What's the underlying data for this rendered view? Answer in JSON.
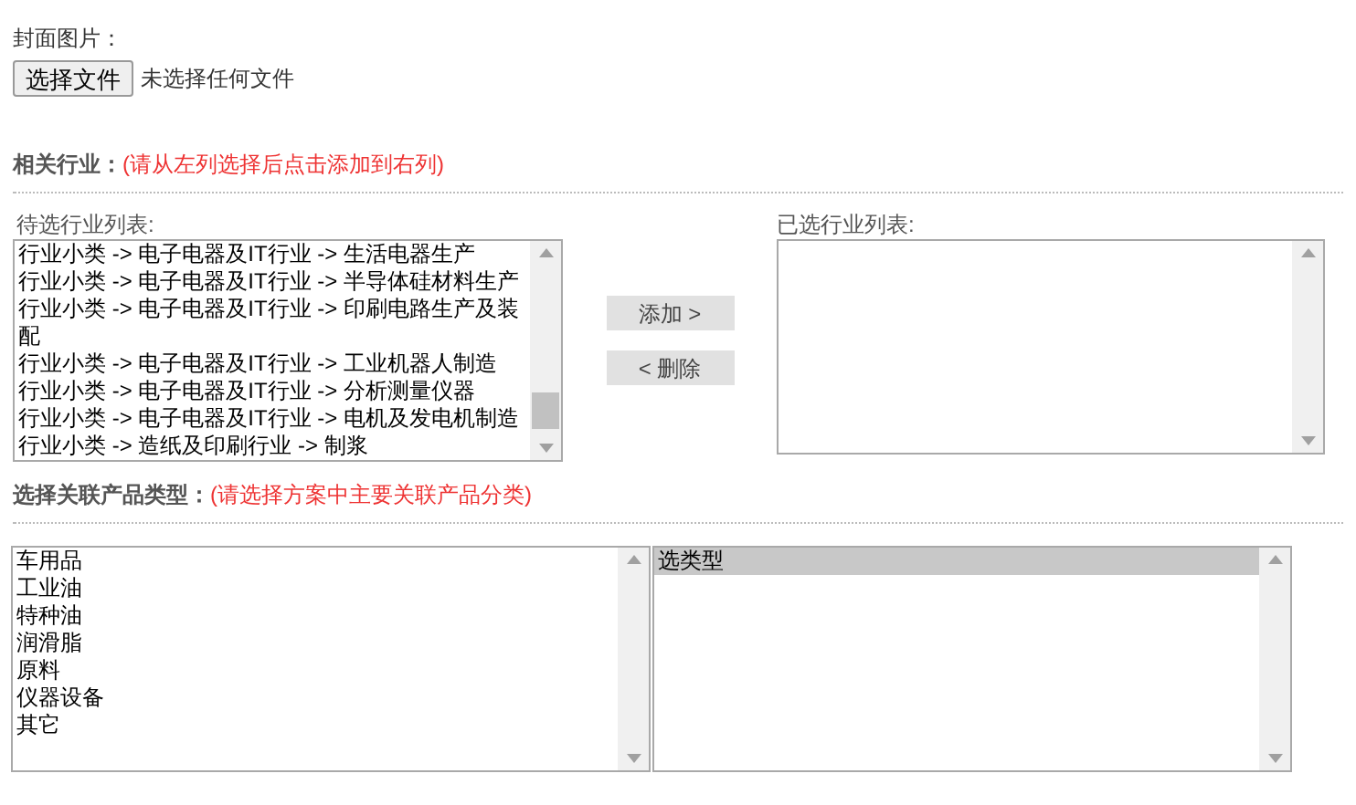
{
  "cover": {
    "label": "封面图片：",
    "button": "选择文件",
    "status": "未选择任何文件"
  },
  "industry": {
    "label": "相关行业：",
    "hint": "(请从左列选择后点击添加到右列)",
    "available_label": "待选行业列表:",
    "available": [
      {
        "text": "行业小类 -> 电子电器及IT行业 -> 生活电器生产",
        "selected": false
      },
      {
        "text": "行业小类 -> 电子电器及IT行业 -> 半导体硅材料生产",
        "selected": false
      },
      {
        "text": "行业小类 -> 电子电器及IT行业 -> 印刷电路生产及装配",
        "selected": false
      },
      {
        "text": "行业小类 -> 电子电器及IT行业 -> 工业机器人制造",
        "selected": false
      },
      {
        "text": "行业小类 -> 电子电器及IT行业 -> 分析测量仪器",
        "selected": false
      },
      {
        "text": "行业小类 -> 电子电器及IT行业 -> 电机及发电机制造",
        "selected": false
      },
      {
        "text": "行业小类 -> 造纸及印刷行业 -> 制浆",
        "selected": false
      }
    ],
    "buttons": [
      "添加 >",
      "< 删除"
    ],
    "chosen_label": "已选行业列表:"
  },
  "products": {
    "label": "选择关联产品类型：",
    "hint": "(请选择方案中主要关联产品分类)",
    "categories": [
      {
        "text": "车用品",
        "selected": false
      },
      {
        "text": "工业油",
        "selected": false
      },
      {
        "text": "特种油",
        "selected": false
      },
      {
        "text": "润滑脂",
        "selected": false
      },
      {
        "text": "原料",
        "selected": false
      },
      {
        "text": "仪器设备",
        "selected": false
      },
      {
        "text": "其它",
        "selected": false
      }
    ],
    "types": [
      {
        "text": "选类型",
        "selected": true
      }
    ]
  }
}
